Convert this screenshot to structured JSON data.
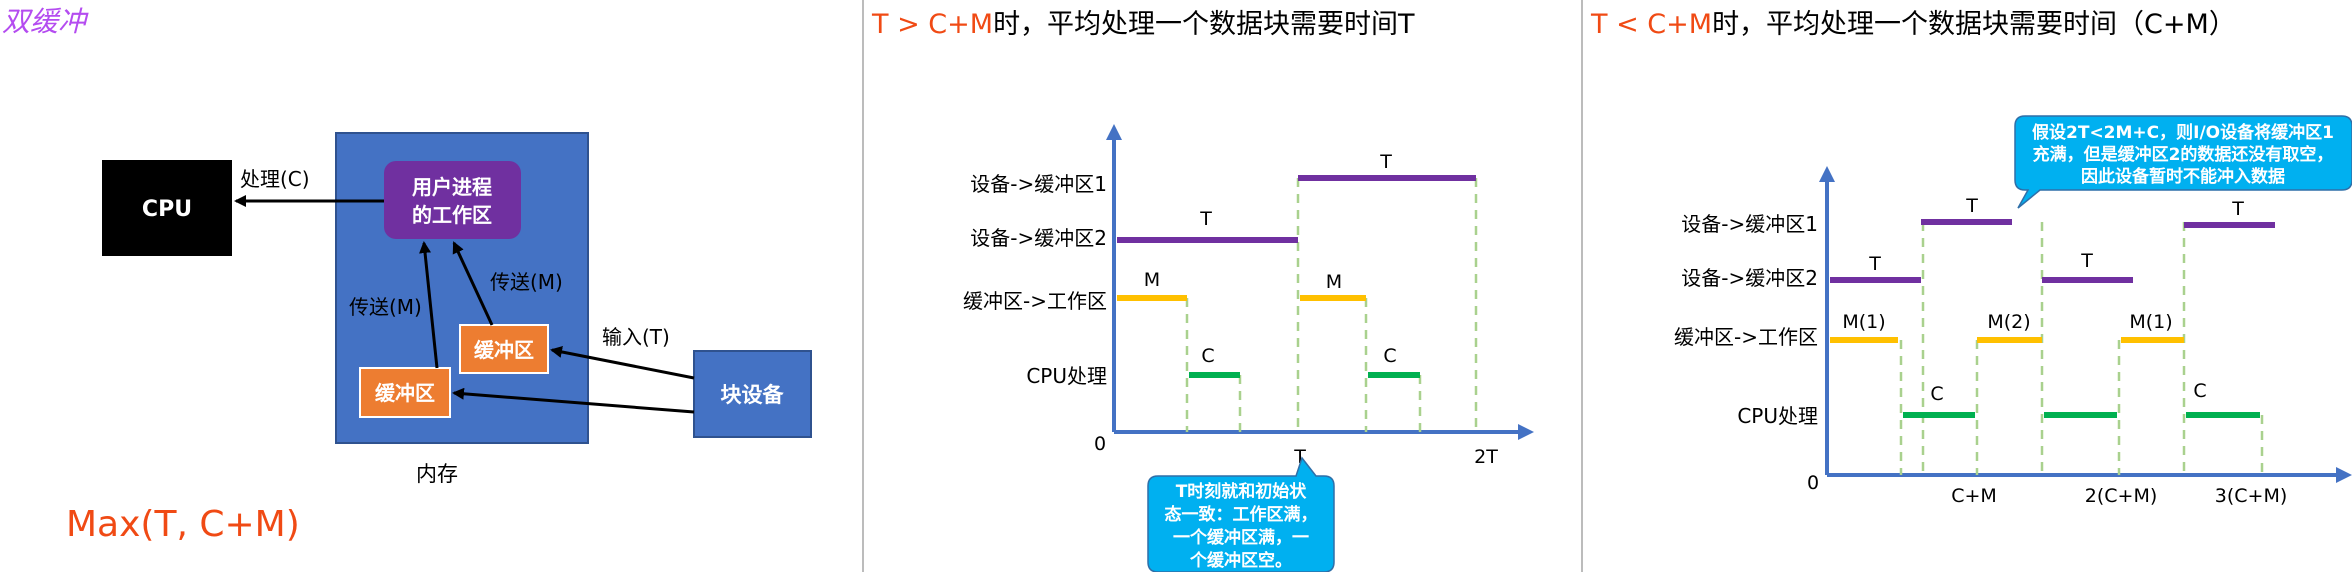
{
  "colors": {
    "title_purple": "#b44cf0",
    "accent_orange": "#f04a14",
    "memory_blue": "#4472c4",
    "process_purple": "#7030a0",
    "buffer_orange": "#ed7d31",
    "axis_blue": "#4472c4",
    "bar_purple": "#7030a0",
    "bar_yellow": "#ffc000",
    "bar_green": "#00b050",
    "dash_green": "#a9d18e",
    "callout_blue": "#00b0f0",
    "divider_gray": "#a6a6a6"
  },
  "left_panel": {
    "title": "双缓冲",
    "cpu_label": "CPU",
    "user_process_line1": "用户进程",
    "user_process_line2": "的工作区",
    "buffer1_label": "缓冲区",
    "buffer2_label": "缓冲区",
    "block_device_label": "块设备",
    "memory_label": "内存",
    "process_arrow_label": "处理(C)",
    "transfer1_label": "传送(M)",
    "transfer2_label": "传送(M)",
    "input_label": "输入(T)",
    "formula": "Max(T, C+M)"
  },
  "middle_panel": {
    "title_part1": "T > C+M",
    "title_part2": "时，平均处理一个数据块需要时间T",
    "row_labels": [
      "设备->缓冲区1",
      "设备->缓冲区2",
      "缓冲区->工作区",
      "CPU处理"
    ],
    "origin_label": "0",
    "x_ticks": [
      "T",
      "2T"
    ],
    "bar_labels": [
      "T",
      "T",
      "M",
      "M",
      "C",
      "C"
    ],
    "callout_text": [
      "T时刻就和初始状",
      "态一致：工作区满，",
      "一个缓冲区满，一",
      "个缓冲区空。"
    ]
  },
  "right_panel": {
    "title_part1": "T < C+M",
    "title_part2": "时，平均处理一个数据块需要时间（C+M）",
    "row_labels": [
      "设备->缓冲区1",
      "设备->缓冲区2",
      "缓冲区->工作区",
      "CPU处理"
    ],
    "origin_label": "0",
    "x_ticks": [
      "C+M",
      "2(C+M)",
      "3(C+M)"
    ],
    "bar_labels": [
      "T",
      "T",
      "T",
      "T",
      "M(1)",
      "M(2)",
      "M(1)",
      "C",
      "C"
    ],
    "callout_text": [
      "假设2T<2M+C，则I/O设备将缓冲区1",
      "充满，但是缓冲区2的数据还没有取空，",
      "因此设备暂时不能冲入数据"
    ]
  },
  "chart_data": [
    {
      "type": "timeline",
      "title": "T > C+M时，平均处理一个数据块需要时间T",
      "rows": [
        "设备->缓冲区1",
        "设备->缓冲区2",
        "缓冲区->工作区",
        "CPU处理"
      ],
      "ticks": [
        "0",
        "T",
        "2T"
      ],
      "segments": [
        {
          "row": "设备->缓冲区2",
          "label": "T",
          "start": 0,
          "end": 1
        },
        {
          "row": "设备->缓冲区1",
          "label": "T",
          "start": 1,
          "end": 2
        },
        {
          "row": "缓冲区->工作区",
          "label": "M",
          "start": 0,
          "end": 0.38
        },
        {
          "row": "CPU处理",
          "label": "C",
          "start": 0.4,
          "end": 0.7
        },
        {
          "row": "缓冲区->工作区",
          "label": "M",
          "start": 1,
          "end": 1.38
        },
        {
          "row": "CPU处理",
          "label": "C",
          "start": 1.4,
          "end": 1.7
        }
      ]
    },
    {
      "type": "timeline",
      "title": "T < C+M时，平均处理一个数据块需要时间（C+M）",
      "rows": [
        "设备->缓冲区1",
        "设备->缓冲区2",
        "缓冲区->工作区",
        "CPU处理"
      ],
      "ticks": [
        "0",
        "C+M",
        "2(C+M)",
        "3(C+M)"
      ],
      "segments": [
        {
          "row": "设备->缓冲区2",
          "label": "T",
          "start": 0,
          "end": 0.8
        },
        {
          "row": "设备->缓冲区1",
          "label": "T",
          "start": 0.8,
          "end": 1.6
        },
        {
          "row": "设备->缓冲区2",
          "label": "T",
          "start": 1.9,
          "end": 2.4
        },
        {
          "row": "设备->缓冲区1",
          "label": "T",
          "start": 3.0,
          "end": 3.4
        },
        {
          "row": "缓冲区->工作区",
          "label": "M(1)",
          "start": 0,
          "end": 0.6
        },
        {
          "row": "CPU处理",
          "label": "C",
          "start": 0.65,
          "end": 1.35
        },
        {
          "row": "缓冲区->工作区",
          "label": "M(2)",
          "start": 1.35,
          "end": 1.95
        },
        {
          "row": "CPU处理",
          "label": "",
          "start": 1.95,
          "end": 2.65
        },
        {
          "row": "缓冲区->工作区",
          "label": "M(1)",
          "start": 2.65,
          "end": 3.25
        },
        {
          "row": "CPU处理",
          "label": "C",
          "start": 3.25,
          "end": 3.95
        }
      ]
    }
  ]
}
